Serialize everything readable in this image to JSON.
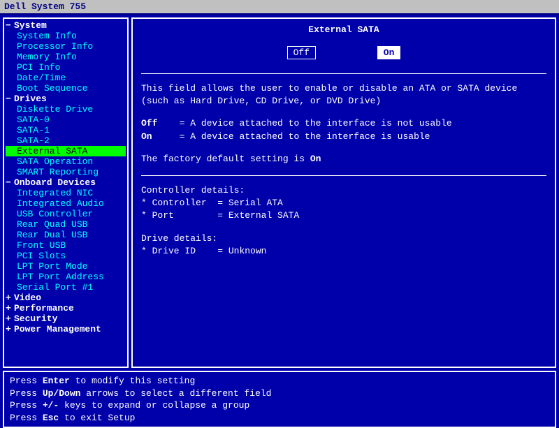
{
  "title": "Dell System 755",
  "sidebar": {
    "groups": [
      {
        "label": "System",
        "expanded": true,
        "items": [
          "System Info",
          "Processor Info",
          "Memory Info",
          "PCI Info",
          "Date/Time",
          "Boot Sequence"
        ]
      },
      {
        "label": "Drives",
        "expanded": true,
        "items": [
          "Diskette Drive",
          "SATA-0",
          "SATA-1",
          "SATA-2",
          "External SATA",
          "SATA Operation",
          "SMART Reporting"
        ],
        "selected_index": 4
      },
      {
        "label": "Onboard Devices",
        "expanded": true,
        "items": [
          "Integrated NIC",
          "Integrated Audio",
          "USB Controller",
          "Rear Quad USB",
          "Rear Dual USB",
          "Front USB",
          "PCI Slots",
          "LPT Port Mode",
          "LPT Port Address",
          "Serial Port #1"
        ]
      },
      {
        "label": "Video",
        "expanded": false,
        "items": []
      },
      {
        "label": "Performance",
        "expanded": false,
        "items": []
      },
      {
        "label": "Security",
        "expanded": false,
        "items": []
      },
      {
        "label": "Power Management",
        "expanded": false,
        "items": []
      }
    ]
  },
  "content": {
    "title": "External SATA",
    "options": {
      "off": "Off",
      "on": "On",
      "selected": "On"
    },
    "description": "This field allows the user to enable or disable an ATA or SATA device (such as Hard Drive, CD Drive, or DVD Drive)",
    "off_label": "Off",
    "off_desc": "= A device attached to the interface is not usable",
    "on_label": "On",
    "on_desc": "= A device attached to the interface is usable",
    "default_prefix": "The factory default setting is ",
    "default_value": "On",
    "controller_heading": "Controller details:",
    "controller_label": "* Controller",
    "controller_value": "= Serial ATA",
    "port_label": "* Port",
    "port_value": "= External SATA",
    "drive_heading": "Drive details:",
    "driveid_label": "* Drive ID",
    "driveid_value": "= Unknown"
  },
  "footer": {
    "l1a": "Press ",
    "l1b": "Enter",
    "l1c": " to modify this setting",
    "l2a": "Press ",
    "l2b": "Up/Down",
    "l2c": " arrows to select a different field",
    "l3a": "Press ",
    "l3b": "+/-",
    "l3c": " keys to expand or collapse a group",
    "l4a": "Press ",
    "l4b": "Esc",
    "l4c": " to exit Setup"
  }
}
